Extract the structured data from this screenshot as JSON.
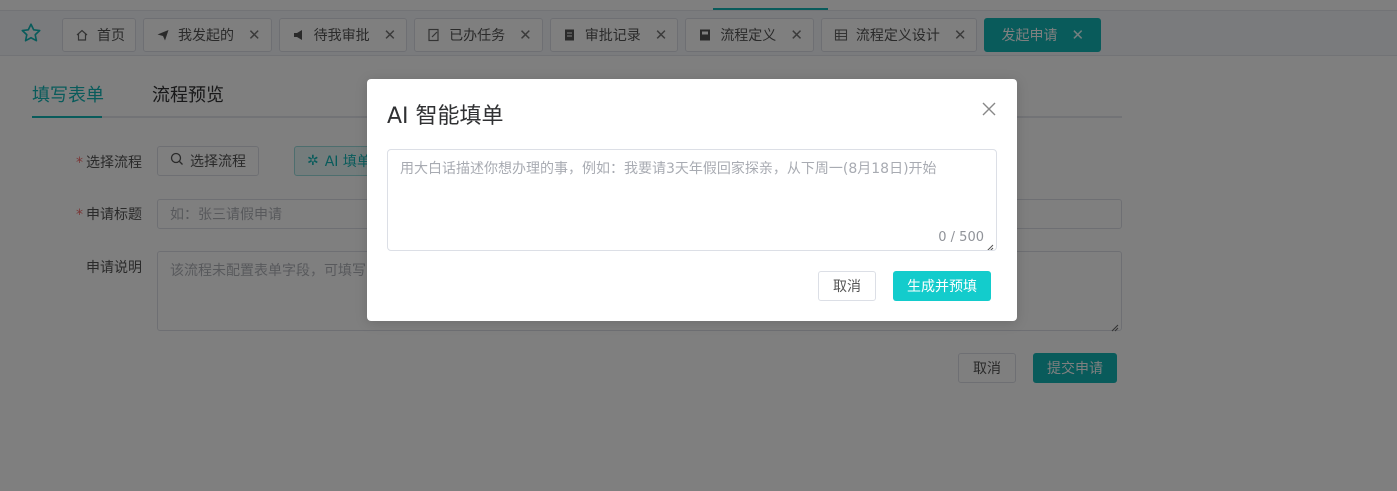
{
  "tabs": [
    {
      "label": "首页",
      "icon": "home-icon",
      "closable": false
    },
    {
      "label": "我发起的",
      "icon": "send-icon",
      "closable": true
    },
    {
      "label": "待我审批",
      "icon": "megaphone-icon",
      "closable": true
    },
    {
      "label": "已办任务",
      "icon": "edit-doc-icon",
      "closable": true
    },
    {
      "label": "审批记录",
      "icon": "record-icon",
      "closable": true
    },
    {
      "label": "流程定义",
      "icon": "notebook-icon",
      "closable": true
    },
    {
      "label": "流程定义设计",
      "icon": "grid-icon",
      "closable": true
    },
    {
      "label": "发起申请",
      "icon": "",
      "closable": true,
      "active": true
    }
  ],
  "subtabs": {
    "fill_form": "填写表单",
    "preview": "流程预览"
  },
  "form": {
    "select_process_label": "选择流程",
    "select_process_button": "选择流程",
    "ai_fill_button": "AI 填单",
    "title_label": "申请标题",
    "title_placeholder": "如：张三请假申请",
    "desc_label": "申请说明",
    "desc_placeholder": "该流程未配置表单字段，可填写申请说明",
    "cancel": "取消",
    "submit": "提交申请"
  },
  "dialog": {
    "title": "AI 智能填单",
    "placeholder": "用大白话描述你想办理的事，例如：我要请3天年假回家探亲，从下周一(8月18日)开始",
    "counter": "0 / 500",
    "cancel": "取消",
    "confirm": "生成并预填"
  },
  "colors": {
    "accent": "#13b7b7",
    "required": "#f56c6c"
  }
}
